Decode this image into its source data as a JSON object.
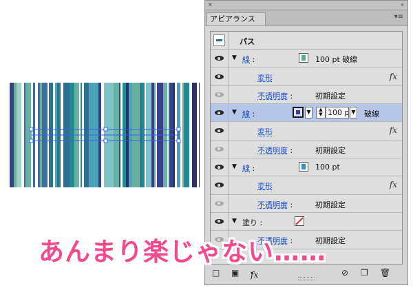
{
  "panel": {
    "title_bar": {
      "close": "×",
      "collapse": "«"
    },
    "tab_label": "アピアランス",
    "menu_icon": "panel-menu-icon",
    "header": {
      "object_label": "パス"
    },
    "rows": [
      {
        "kind": "stroke",
        "label": "線",
        "value": "100 pt 破線",
        "swatch_color": "#5aaa9a",
        "expanded": true
      },
      {
        "kind": "effect",
        "label": "変形"
      },
      {
        "kind": "opacity",
        "label": "不透明度",
        "value": "初期設定"
      },
      {
        "kind": "stroke-selected",
        "label": "線",
        "weight_value": "100 p",
        "value": "破線",
        "swatch_color": "#3a3f86"
      },
      {
        "kind": "effect",
        "label": "変形"
      },
      {
        "kind": "opacity",
        "label": "不透明度",
        "value": "初期設定"
      },
      {
        "kind": "stroke",
        "label": "線",
        "value": "100 pt",
        "swatch_color": "#3a90c8",
        "expanded": true
      },
      {
        "kind": "effect",
        "label": "変形"
      },
      {
        "kind": "opacity",
        "label": "不透明度",
        "value": "初期設定"
      },
      {
        "kind": "fill",
        "label": "塗り",
        "swatch_color": "#e03040"
      },
      {
        "kind": "opacity",
        "label": "不透明度",
        "value": "初期設定"
      }
    ],
    "footer": {
      "add_stroke_icon": "add-stroke-icon",
      "add_fill_icon": "add-fill-icon",
      "fx_label": "fx",
      "clear_icon": "clear-appearance-icon",
      "duplicate_icon": "duplicate-item-icon",
      "delete_icon": "trash-icon"
    }
  },
  "colors": {
    "accent_pink": "#f24a8f",
    "selection_blue": "#b5c6e8",
    "link_blue": "#1d4fd0",
    "stripe_colors": [
      "#2f2f6e",
      "#3b3f8a",
      "#2e6f92",
      "#4aa3b8",
      "#68b0a2",
      "#9fd1c4",
      "#1f8a8f",
      "#7fc3c8",
      "#3f6e9e"
    ]
  },
  "caption": {
    "text": "あんまり楽じゃない……"
  }
}
